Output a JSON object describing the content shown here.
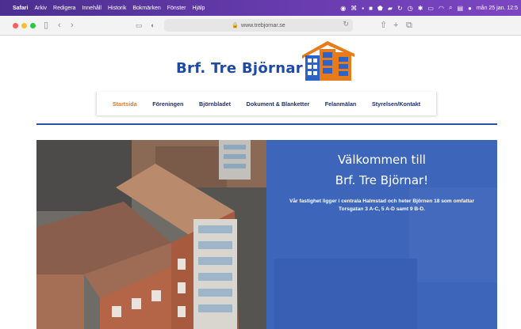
{
  "menubar": {
    "apple": "",
    "app_name": "Safari",
    "items": [
      "Arkiv",
      "Redigera",
      "Innehåll",
      "Historik",
      "Bokmärken",
      "Fönster",
      "Hjälp"
    ],
    "datetime": "mån 25 jan.  12:5"
  },
  "browser": {
    "url": "www.trebjornar.se"
  },
  "site": {
    "logo_text": "Brf. Tre Björnar",
    "nav": [
      "Startsida",
      "Föreningen",
      "Björnbladet",
      "Dokument & Blanketter",
      "Felanmälan",
      "Styrelsen/Kontakt"
    ],
    "active_nav": "Startsida"
  },
  "hero": {
    "title_line1": "Välkommen till",
    "title_line2": "Brf. Tre Björnar!",
    "description": "Vår fastighet ligger i centrala Halmstad och heter Björnen 18 som omfattar Torsgatan 3 A-C, 5 A-D samt 9 B-D."
  },
  "colors": {
    "brand_blue": "#1e4aa6",
    "accent_orange": "#e87a1a",
    "overlay_blue": "#305fc8"
  }
}
